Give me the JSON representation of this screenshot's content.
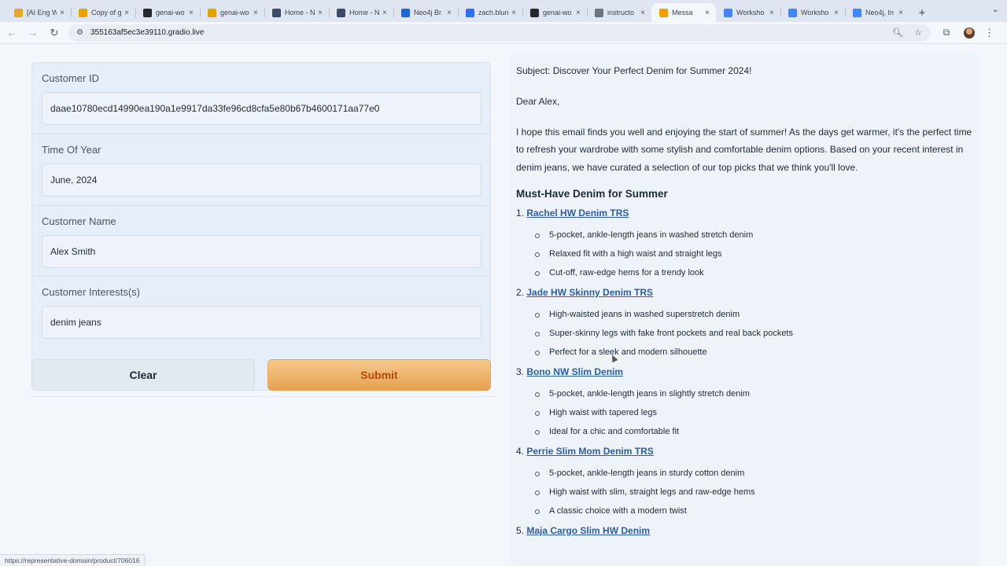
{
  "browser": {
    "tabs": [
      {
        "title": "[AI Eng W",
        "icon": "bookmark-icon",
        "color": "#e3a72f",
        "active": false
      },
      {
        "title": "Copy of g",
        "icon": "colab-icon",
        "color": "#e8a200",
        "active": false
      },
      {
        "title": "genai-wo",
        "icon": "github-icon",
        "color": "#24292f",
        "active": false
      },
      {
        "title": "genai-wo",
        "icon": "colab-icon",
        "color": "#e8a200",
        "active": false
      },
      {
        "title": "Home - N",
        "icon": "neo4j-icon",
        "color": "#3b4a66",
        "active": false
      },
      {
        "title": "Home - N",
        "icon": "neo4j-icon",
        "color": "#3b4a66",
        "active": false
      },
      {
        "title": "Neo4j Br",
        "icon": "neo4j-browser-icon",
        "color": "#1967d2",
        "active": false
      },
      {
        "title": "zach.blun",
        "icon": "zoom-icon",
        "color": "#2d6fea",
        "active": false
      },
      {
        "title": "genai-wo",
        "icon": "github-icon",
        "color": "#24292f",
        "active": false
      },
      {
        "title": "instructo",
        "icon": "link-icon",
        "color": "#6b7280",
        "active": false
      },
      {
        "title": "Messa",
        "icon": "gradio-icon",
        "color": "#f59e0b",
        "active": true
      },
      {
        "title": "Worksho",
        "icon": "docs-icon",
        "color": "#4285f4",
        "active": false
      },
      {
        "title": "Worksho",
        "icon": "docs-icon",
        "color": "#4285f4",
        "active": false
      },
      {
        "title": "Neo4j, In",
        "icon": "calendar-icon",
        "color": "#4285f4",
        "active": false
      }
    ],
    "url": "355163af5ec3e39110.gradio.live",
    "status_url": "https://representative-domain/product/706016"
  },
  "form": {
    "fields": [
      {
        "label": "Customer ID",
        "value": "daae10780ecd14990ea190a1e9917da33fe96cd8cfa5e80b67b4600171aa77e0"
      },
      {
        "label": "Time Of Year",
        "value": "June, 2024"
      },
      {
        "label": "Customer Name",
        "value": "Alex Smith"
      },
      {
        "label": "Customer Interests(s)",
        "value": "denim jeans"
      }
    ],
    "clear_label": "Clear",
    "submit_label": "Submit"
  },
  "email": {
    "subject": "Subject: Discover Your Perfect Denim for Summer 2024!",
    "greeting": "Dear Alex,",
    "intro": "I hope this email finds you well and enjoying the start of summer! As the days get warmer, it's the perfect time to refresh your wardrobe with some stylish and comfortable denim options. Based on your recent interest in denim jeans, we have curated a selection of our top picks that we think you'll love.",
    "section_heading": "Must-Have Denim for Summer",
    "products": [
      {
        "num": "1.",
        "name": "Rachel HW Denim TRS",
        "bullets": [
          "5-pocket, ankle-length jeans in washed stretch denim",
          "Relaxed fit with a high waist and straight legs",
          "Cut-off, raw-edge hems for a trendy look"
        ]
      },
      {
        "num": "2.",
        "name": "Jade HW Skinny Denim TRS",
        "bullets": [
          "High-waisted jeans in washed superstretch denim",
          "Super-skinny legs with fake front pockets and real back pockets",
          "Perfect for a sleek and modern silhouette"
        ]
      },
      {
        "num": "3.",
        "name": "Bono NW Slim Denim",
        "bullets": [
          "5-pocket, ankle-length jeans in slightly stretch denim",
          "High waist with tapered legs",
          "Ideal for a chic and comfortable fit"
        ]
      },
      {
        "num": "4.",
        "name": "Perrie Slim Mom Denim TRS",
        "bullets": [
          "5-pocket, ankle-length jeans in sturdy cotton denim",
          "High waist with slim, straight legs and raw-edge hems",
          "A classic choice with a modern twist"
        ]
      },
      {
        "num": "5.",
        "name": "Maja Cargo Slim HW Denim",
        "bullets": []
      }
    ]
  }
}
